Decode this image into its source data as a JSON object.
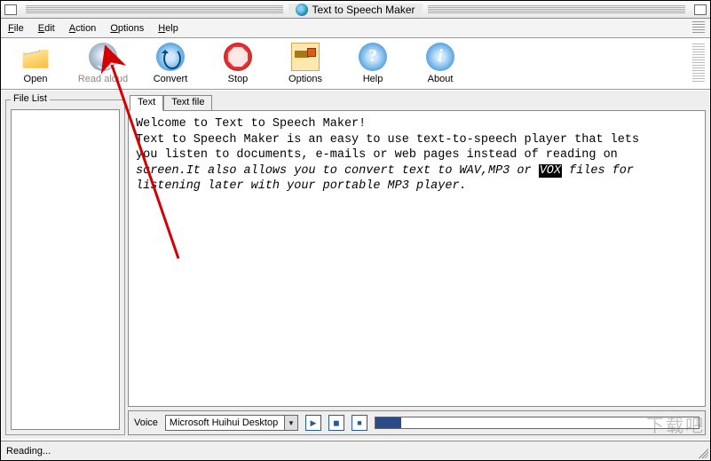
{
  "window": {
    "title": "Text to Speech Maker"
  },
  "menu": {
    "file": "File",
    "edit": "Edit",
    "action": "Action",
    "options": "Options",
    "help": "Help"
  },
  "toolbar": {
    "open": "Open",
    "read_aloud": "Read aloud",
    "convert": "Convert",
    "stop": "Stop",
    "options": "Options",
    "help": "Help",
    "about": "About"
  },
  "sidebar": {
    "file_list_label": "File List"
  },
  "tabs": {
    "text": "Text",
    "text_file": "Text file"
  },
  "content": {
    "line1": "Welcome to Text to Speech Maker!",
    "line2": "Text to Speech Maker is an easy to use text-to-speech player that lets",
    "line3": "you listen to documents, e-mails or web pages instead of reading on",
    "line4a": "screen.It also allows you to convert text to WAV,MP3 or ",
    "line4_highlight": "VOX",
    "line4b": " files for",
    "line5": "listening later with your portable MP3 player."
  },
  "player": {
    "voice_label": "Voice",
    "voice_selected": "Microsoft Huihui Desktop",
    "progress_pct": 8
  },
  "status": {
    "text": "Reading..."
  },
  "watermark": "下载吧"
}
